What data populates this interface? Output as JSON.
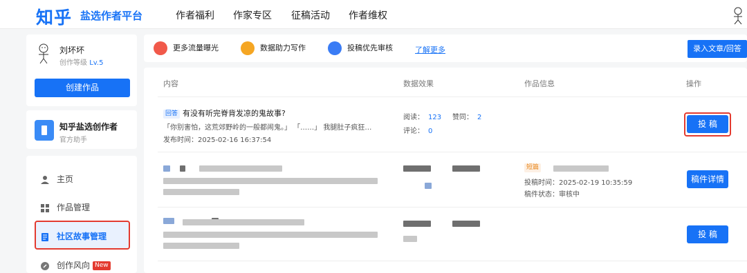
{
  "header": {
    "logo": "知乎",
    "platform": "盐选作者平台",
    "nav": [
      "作者福利",
      "作家专区",
      "征稿活动",
      "作者维权"
    ]
  },
  "sidebar": {
    "user": {
      "name": "刘坏坏",
      "level_label": "创作等级",
      "level": "Lv.5"
    },
    "create_button": "创建作品",
    "helper": {
      "name": "知乎盐选创作者",
      "sub": "官方助手"
    },
    "items": [
      {
        "label": "主页",
        "icon": "person-icon"
      },
      {
        "label": "作品管理",
        "icon": "grid-icon"
      },
      {
        "label": "社区故事管理",
        "icon": "list-icon",
        "active": true
      },
      {
        "label": "创作风向",
        "icon": "compass-icon",
        "badge": "New"
      }
    ]
  },
  "features": {
    "items": [
      {
        "label": "更多流量曝光",
        "icon": "flame-icon",
        "color": "#f1594a"
      },
      {
        "label": "数据助力写作",
        "icon": "chart-icon",
        "color": "#f5a623"
      },
      {
        "label": "投稿优先审核",
        "icon": "user-icon",
        "color": "#3a7cf5"
      }
    ],
    "learn_more": "了解更多",
    "record_button": "录入文章/回答"
  },
  "table": {
    "headers": [
      "内容",
      "数据效果",
      "作品信息",
      "操作"
    ],
    "row1": {
      "tag": "回答",
      "title": "有没有听完脊背发凉的鬼故事?",
      "excerpt": "「你别害怕，这荒郊野岭的一般都闹鬼。」 「……」 我腿肚子疯狂…",
      "published": "发布时间：2025-02-16 16:37:54",
      "reads_label": "阅读：",
      "reads": "123",
      "likes_label": "赞同：",
      "likes": "2",
      "comments_label": "评论：",
      "comments": "0",
      "action": "投 稿"
    },
    "row2": {
      "tag": "短篇",
      "submit_time": "投稿时间：2025-02-19 10:35:59",
      "status": "稿件状态：审核中",
      "action": "稿件详情"
    },
    "row3": {
      "action": "投 稿"
    }
  },
  "colors": {
    "accent": "#1772f6",
    "highlight": "#e33a2f"
  }
}
